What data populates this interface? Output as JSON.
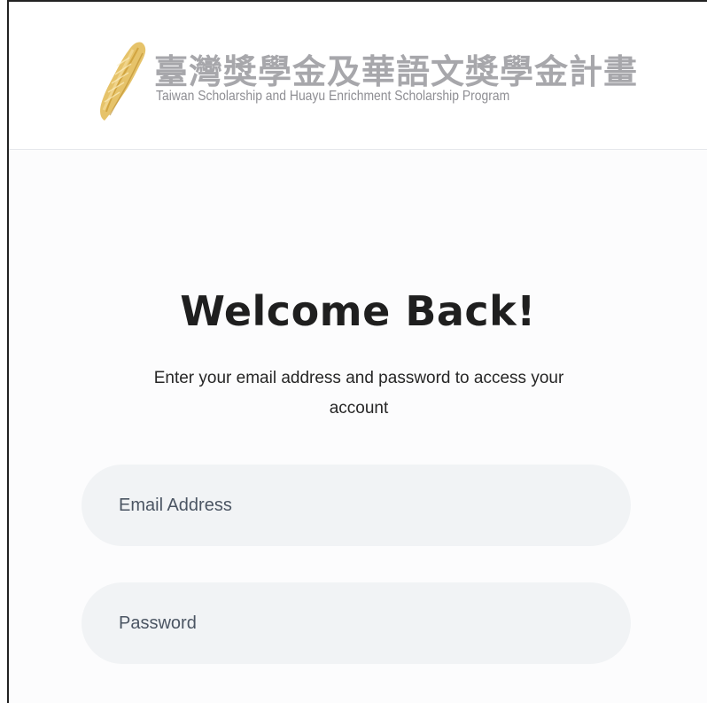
{
  "header": {
    "logo_title_cn": "臺灣獎學金及華語文獎學金計畫",
    "logo_subtitle_en": "Taiwan Scholarship and Huayu Enrichment Scholarship Program",
    "logo_icon": "taiwan-map-logo-icon"
  },
  "login": {
    "title": "Welcome Back!",
    "subtitle": "Enter your email address and password to access your account",
    "email_placeholder": "Email Address",
    "email_value": "",
    "password_placeholder": "Password",
    "password_value": ""
  },
  "colors": {
    "logo_gold": "#d9b25a",
    "logo_text_gray": "#a7a7ab",
    "field_background": "#f1f3f5",
    "title_text": "#1f1f1f"
  }
}
